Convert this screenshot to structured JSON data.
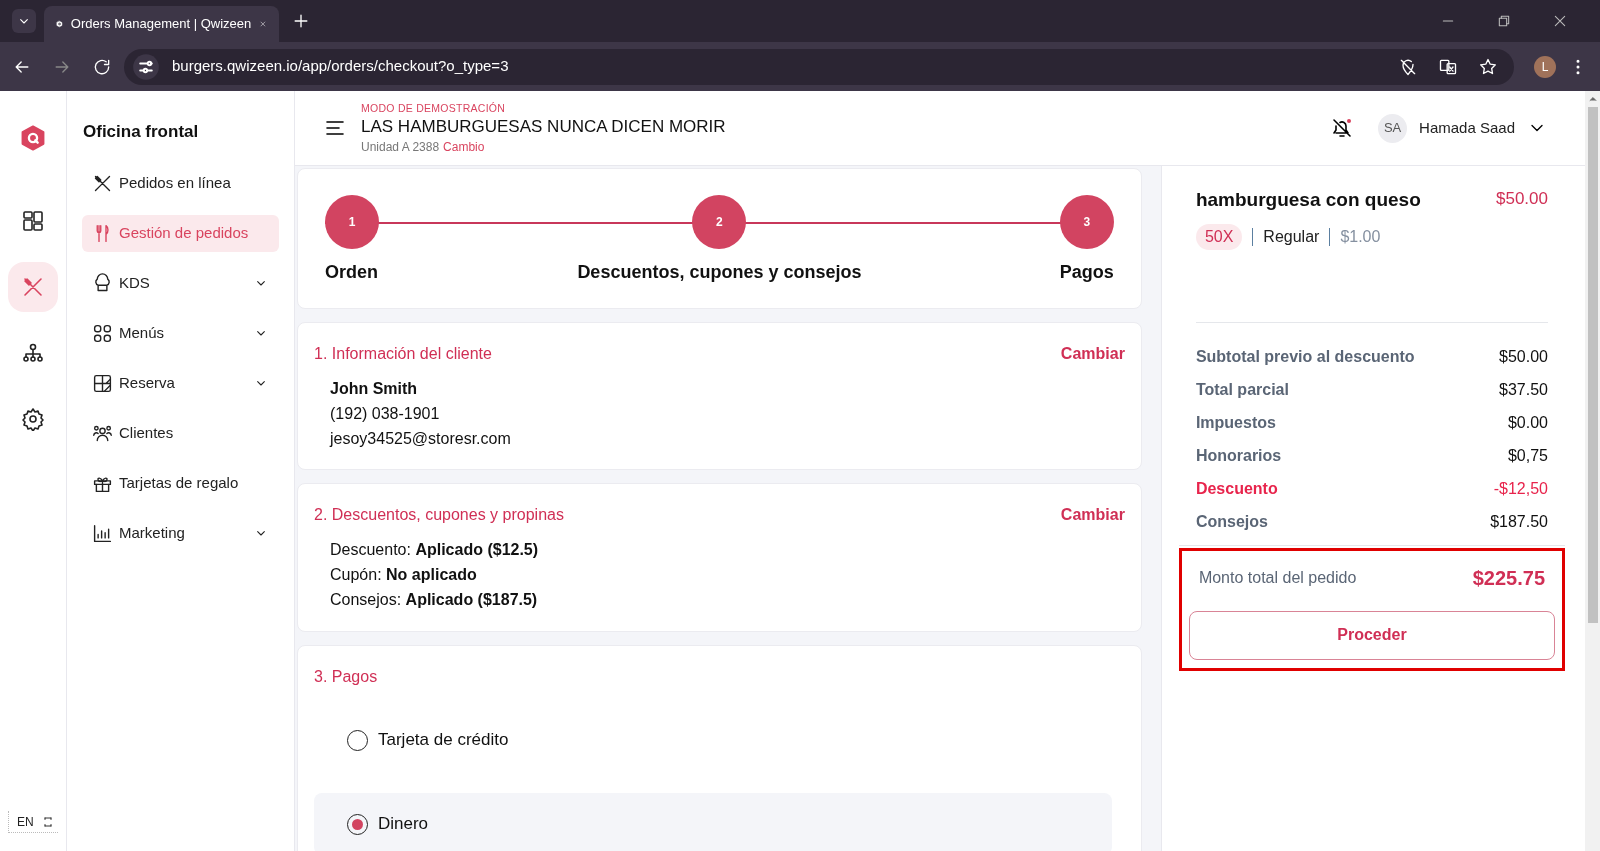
{
  "browser": {
    "tab_title": "Orders Management | Qwizeen",
    "url": "burgers.qwizeen.io/app/orders/checkout?o_type=3",
    "profile_initial": "L"
  },
  "rail": [
    {
      "selected": false
    },
    {
      "selected": false
    },
    {
      "selected": true
    },
    {
      "selected": false
    },
    {
      "selected": false
    }
  ],
  "language": "EN",
  "sidebar": {
    "title": "Oficina frontal",
    "items": [
      {
        "label": "Pedidos en línea",
        "expandable": false,
        "selected": false
      },
      {
        "label": "Gestión de pedidos",
        "expandable": false,
        "selected": true
      },
      {
        "label": "KDS",
        "expandable": true,
        "selected": false
      },
      {
        "label": "Menús",
        "expandable": true,
        "selected": false
      },
      {
        "label": "Reserva",
        "expandable": true,
        "selected": false
      },
      {
        "label": "Clientes",
        "expandable": false,
        "selected": false
      },
      {
        "label": "Tarjetas de regalo",
        "expandable": false,
        "selected": false
      },
      {
        "label": "Marketing",
        "expandable": true,
        "selected": false
      }
    ]
  },
  "header": {
    "mode": "MODO DE DEMOSTRACIÓN",
    "restaurant": "LAS HAMBURGUESAS NUNCA DICEN MORIR",
    "unit": "Unidad A 2388",
    "change_link": "Cambio",
    "user_initials": "SA",
    "user_name": "Hamada Saad"
  },
  "steps": [
    {
      "number": "1",
      "label": "Orden"
    },
    {
      "number": "2",
      "label": "Descuentos, cupones y consejos"
    },
    {
      "number": "3",
      "label": "Pagos"
    }
  ],
  "customer": {
    "title": "1. Información del cliente",
    "action": "Cambiar",
    "name": "John Smith",
    "phone": "(192) 038-1901",
    "email": "jesoy34525@storesr.com"
  },
  "discounts": {
    "title": "2. Descuentos, cupones y propinas",
    "action": "Cambiar",
    "lines": [
      "Descuento: **Aplicado ($12.5)**",
      "Cupón: **No aplicado**",
      "Consejos: **Aplicado ($187.5)**"
    ]
  },
  "payments": {
    "title": "3. Pagos",
    "options": [
      {
        "label": "Tarjeta de crédito",
        "selected": false
      },
      {
        "label": "Dinero",
        "selected": true
      }
    ]
  },
  "order": {
    "item": {
      "name": "hamburguesa con queso",
      "price": "$50.00",
      "quantity": "50X",
      "size": "Regular",
      "unit_price": "$1.00"
    },
    "summary": [
      {
        "label": "Subtotal previo al descuento",
        "value": "$50.00",
        "kind": "normal"
      },
      {
        "label": "Total parcial",
        "value": "$37.50",
        "kind": "normal"
      },
      {
        "label": "Impuestos",
        "value": "$0.00",
        "kind": "normal"
      },
      {
        "label": "Honorarios",
        "value": "$0,75",
        "kind": "normal"
      },
      {
        "label": "Descuento",
        "value": "-$12,50",
        "kind": "discount"
      },
      {
        "label": "Consejos",
        "value": "$187.50",
        "kind": "normal"
      }
    ],
    "total_label": "Monto total del pedido",
    "total": "$225.75",
    "proceed": "Proceder"
  }
}
